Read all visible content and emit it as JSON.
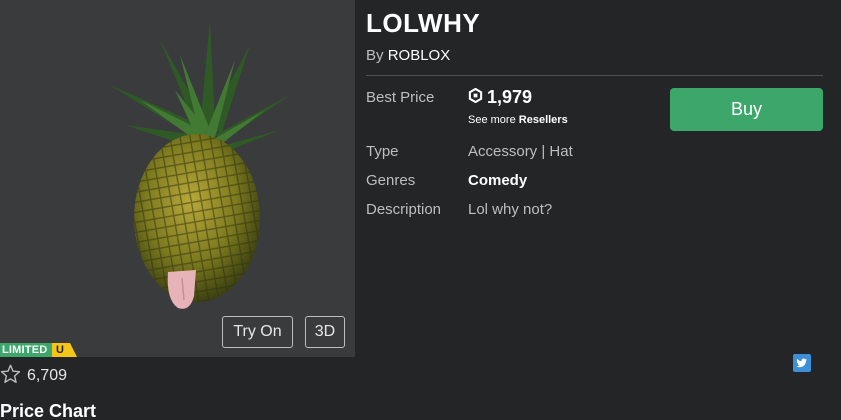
{
  "item": {
    "title": "LOLWHY",
    "by_prefix": "By",
    "creator": "ROBLOX"
  },
  "thumbnail": {
    "try_on_label": "Try On",
    "view_3d_label": "3D",
    "limited_badge": "LIMITED",
    "limited_unique": "U"
  },
  "favorites": {
    "icon": "star-outline-icon",
    "count": "6,709"
  },
  "section_heading": "Price Chart",
  "details": {
    "best_price_label": "Best Price",
    "price_icon": "robux-icon",
    "price": "1,979",
    "see_more_prefix": "See more",
    "see_more_link": "Resellers",
    "type_label": "Type",
    "type_value": "Accessory | Hat",
    "genres_label": "Genres",
    "genres_value": "Comedy",
    "description_label": "Description",
    "description_value": "Lol why not?"
  },
  "buy_button": {
    "label": "Buy",
    "color": "#3ca66b"
  },
  "share": {
    "icon": "twitter-icon",
    "color": "#3d8fd6"
  }
}
